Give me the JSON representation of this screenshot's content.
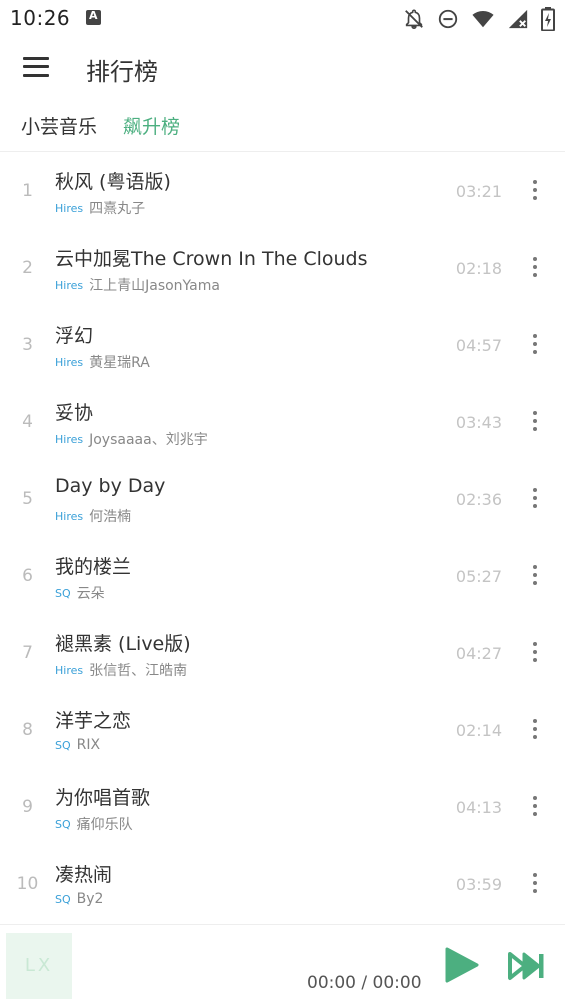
{
  "status_bar": {
    "time": "10:26",
    "icons": [
      "app-notification-icon",
      "notifications-off-icon",
      "do-not-disturb-icon",
      "wifi-icon",
      "signal-icon",
      "battery-charging-icon"
    ]
  },
  "header": {
    "menu_icon": "hamburger-menu-icon",
    "title": "排行榜"
  },
  "tabs": {
    "source": "小芸音乐",
    "board": "飙升榜",
    "active_color": "#4caf80"
  },
  "songs": [
    {
      "index": "1",
      "name": "秋风 (粤语版)",
      "quality": "Hires",
      "artist": "四熹丸子",
      "duration": "03:21"
    },
    {
      "index": "2",
      "name": "云中加冕The Crown In The Clouds",
      "quality": "Hires",
      "artist": "江上青山JasonYama",
      "duration": "02:18"
    },
    {
      "index": "3",
      "name": "浮幻",
      "quality": "Hires",
      "artist": "黄星瑞RA",
      "duration": "04:57"
    },
    {
      "index": "4",
      "name": "妥协",
      "quality": "Hires",
      "artist": "Joysaaaa、刘兆宇",
      "duration": "03:43"
    },
    {
      "index": "5",
      "name": "Day by Day",
      "quality": "Hires",
      "artist": "何浩楠",
      "duration": "02:36"
    },
    {
      "index": "6",
      "name": "我的楼兰",
      "quality": "SQ",
      "artist": "云朵",
      "duration": "05:27"
    },
    {
      "index": "7",
      "name": "褪黑素 (Live版)",
      "quality": "Hires",
      "artist": "张信哲、江皓南",
      "duration": "04:27"
    },
    {
      "index": "8",
      "name": "洋芋之恋",
      "quality": "SQ",
      "artist": "RIX",
      "duration": "02:14"
    },
    {
      "index": "9",
      "name": "为你唱首歌",
      "quality": "SQ",
      "artist": "痛仰乐队",
      "duration": "04:13"
    },
    {
      "index": "10",
      "name": "凑热闹",
      "quality": "SQ",
      "artist": "By2",
      "duration": "03:59"
    }
  ],
  "player": {
    "cover_text": "LX",
    "time": "00:00 / 00:00",
    "play_icon": "play-icon",
    "next_icon": "skip-next-icon",
    "accent_color": "#4caf80"
  }
}
